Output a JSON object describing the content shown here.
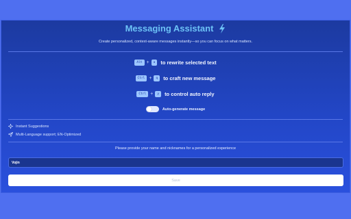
{
  "header": {
    "title": "Messaging Assistant",
    "subtitle": "Create personalized, context-aware messages instantly—so you can focus on what matters.",
    "title_icon": "lightning-bolt-icon"
  },
  "shortcuts": [
    {
      "key1": "Alt",
      "key2": "a",
      "label": "to rewrite selected text"
    },
    {
      "key1": "Ctrl",
      "key2": "q",
      "label": "to craft new message"
    },
    {
      "key1": "Ctrl",
      "key2": "y",
      "label": "to control auto reply"
    }
  ],
  "toggle": {
    "label": "Auto-generate message",
    "enabled": false
  },
  "features": [
    {
      "icon": "sparkle-icon",
      "label": "Instant Suggestions"
    },
    {
      "icon": "send-icon",
      "label": "Multi-Language support; EN-Optimized"
    }
  ],
  "form": {
    "prompt": "Please provide your name and nicknames for a personalized experience",
    "name_value": "Vojin",
    "save_label": "Save"
  },
  "colors": {
    "page_bg": "#4f6ff0",
    "panel_top": "#1c3aa0",
    "panel_bottom": "#2a50dd",
    "title": "#6cc2f6",
    "key_bg": "#9cc6ff"
  }
}
